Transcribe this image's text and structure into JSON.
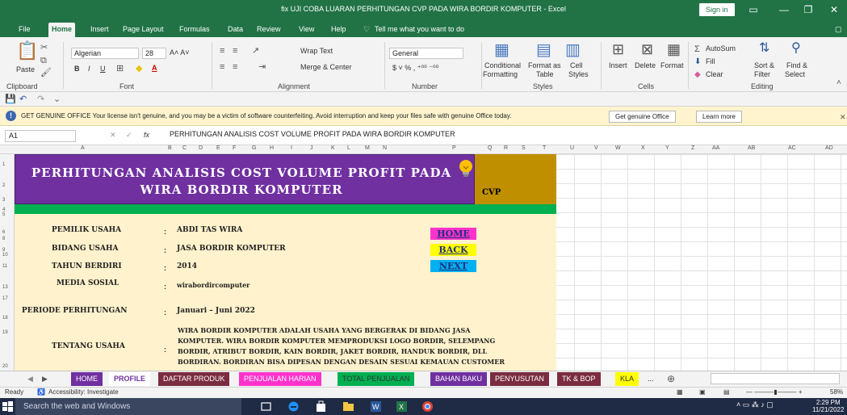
{
  "window": {
    "title": "fix UJI COBA LUARAN PERHITUNGAN CVP PADA WIRA BORDIR KOMPUTER  -  Excel",
    "signin": "Sign in"
  },
  "menu": {
    "tabs": [
      "File",
      "Home",
      "Insert",
      "Page Layout",
      "Formulas",
      "Data",
      "Review",
      "View",
      "Help"
    ],
    "tellme": "Tell me what you want to do"
  },
  "ribbon": {
    "paste": "Paste",
    "font_name": "Algerian",
    "font_size": "28",
    "wrap_text": "Wrap Text",
    "merge_center": "Merge & Center",
    "number_format": "General",
    "conditional": "Conditional",
    "formatting": "Formatting",
    "format_as": "Format as",
    "table": "Table",
    "cell": "Cell",
    "styles_btn": "Styles",
    "insert": "Insert",
    "delete": "Delete",
    "format": "Format",
    "autosum": "AutoSum",
    "fill": "Fill",
    "clear": "Clear",
    "sort_filter": "Sort &",
    "filter": "Filter",
    "find_select": "Find &",
    "select": "Select",
    "groups": [
      "Clipboard",
      "Font",
      "Alignment",
      "Number",
      "Styles",
      "Cells",
      "Editing"
    ]
  },
  "notice": {
    "message": "GET GENUINE OFFICE   Your license isn't genuine, and you may be a victim of software counterfeiting. Avoid interruption and keep your files safe with genuine Office today.",
    "get_genuine": "Get genuine Office",
    "learn_more": "Learn more"
  },
  "formula_bar": {
    "cell_ref": "A1",
    "fx": "fx",
    "content": "PERHITUNGAN ANALISIS COST VOLUME PROFIT PADA WIRA BORDIR KOMPUTER"
  },
  "columns": [
    "A",
    "B",
    "C",
    "D",
    "E",
    "F",
    "G",
    "H",
    "I",
    "J",
    "K",
    "L",
    "M",
    "N",
    "P",
    "Q",
    "R",
    "S",
    "T",
    "U",
    "V",
    "W",
    "X",
    "Y",
    "Z",
    "AA",
    "AB",
    "AC",
    "AD"
  ],
  "rows": [
    "1",
    "2",
    "3",
    "4",
    "5",
    "6",
    "8",
    "9",
    "10",
    "11",
    "13",
    "17",
    "18",
    "19",
    "20"
  ],
  "sheet": {
    "banner_title": "PERHITUNGAN ANALISIS COST VOLUME PROFIT PADA WIRA BORDIR KOMPUTER",
    "cvp_label": "CVP",
    "fields": [
      {
        "label": "PEMILIK USAHA",
        "value": "ABDI TAS WIRA"
      },
      {
        "label": "BIDANG USAHA",
        "value": "JASA BORDIR KOMPUTER"
      },
      {
        "label": "TAHUN BERDIRI",
        "value": "2014"
      },
      {
        "label": "MEDIA SOSIAL",
        "value": "wirabordircomputer"
      },
      {
        "label": "PERIODE PERHITUNGAN",
        "value": "Januari – Juni 2022"
      },
      {
        "label": "TENTANG USAHA",
        "value": "WIRA BORDIR KOMPUTER ADALAH USAHA YANG BERGERAK DI BIDANG JASA KOMPUTER. WIRA BORDIR KOMPUTER MEMPRODUKSI LOGO BORDIR, SELEMPANG BORDIR, ATRIBUT BORDIR, KAIN BORDIR, JAKET BORDIR, HANDUK BORDIR, DLL BORDIRAN. BORDIRAN BISA DIPESAN DENGAN DESAIN SESUAI KEMAUAN CUSTOMER"
      }
    ],
    "colon": ":",
    "nav": {
      "home": "HOME",
      "back": "BACK",
      "next": "NEXT"
    }
  },
  "sheet_tabs": [
    {
      "label": "HOME",
      "bg": "#7030a0",
      "fg": "#ffffff"
    },
    {
      "label": "PROFILE",
      "bg": "#ffffff",
      "fg": "#7030a0"
    },
    {
      "label": "DAFTAR PRODUK",
      "bg": "#7b2c40",
      "fg": "#ffffff"
    },
    {
      "label": "PENJUALAN HARIAN",
      "bg": "#ff33cc",
      "fg": "#ffffff"
    },
    {
      "label": "TOTAL PENJUALAN",
      "bg": "#00b050",
      "fg": "#333333"
    },
    {
      "label": "BAHAN BAKU",
      "bg": "#7030a0",
      "fg": "#ffffff"
    },
    {
      "label": "PENYUSUTAN",
      "bg": "#7b2c40",
      "fg": "#ffffff"
    },
    {
      "label": "TK & BOP",
      "bg": "#7b2c40",
      "fg": "#ffffff"
    },
    {
      "label": "KLA",
      "bg": "#ffff00",
      "fg": "#333333"
    }
  ],
  "sheet_more": "...",
  "status": {
    "ready": "Ready",
    "accessibility": "Accessibility: Investigate",
    "zoom": "58%"
  },
  "taskbar": {
    "search": "Search the web and Windows",
    "time": "2:29 PM",
    "date": "11/21/2022"
  },
  "colors": {
    "excel_green": "#217346",
    "banner_purple": "#7030a0",
    "cvp_gold": "#bf8f00",
    "content_yellow": "#fff2cc",
    "home_btn": "#ff33cc",
    "back_btn": "#ffff00",
    "next_btn": "#00b0f0"
  }
}
